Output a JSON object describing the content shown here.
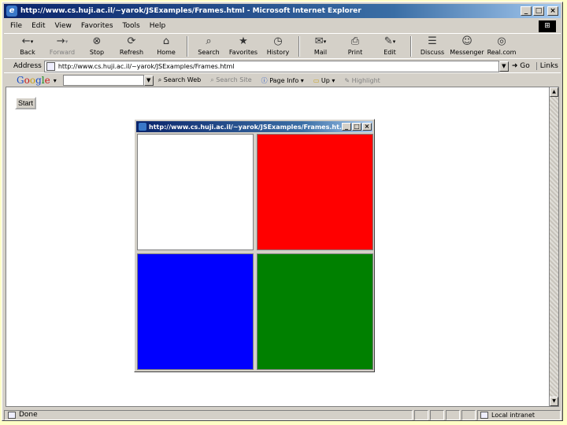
{
  "window": {
    "title": "http://www.cs.huji.ac.il/~yarok/JSExamples/Frames.html - Microsoft Internet Explorer",
    "minimize": "_",
    "maximize": "□",
    "close": "×"
  },
  "menu": [
    "File",
    "Edit",
    "View",
    "Favorites",
    "Tools",
    "Help"
  ],
  "toolbar": [
    {
      "label": "Back",
      "icon": "←",
      "name": "back",
      "dropdown": true,
      "disabled": false
    },
    {
      "label": "Forward",
      "icon": "→",
      "name": "forward",
      "dropdown": true,
      "disabled": true
    },
    {
      "label": "Stop",
      "icon": "⊗",
      "name": "stop",
      "dropdown": false,
      "disabled": false
    },
    {
      "label": "Refresh",
      "icon": "⟳",
      "name": "refresh",
      "dropdown": false,
      "disabled": false
    },
    {
      "label": "Home",
      "icon": "⌂",
      "name": "home",
      "dropdown": false,
      "disabled": false
    },
    {
      "label": "Search",
      "icon": "⌕",
      "name": "search",
      "dropdown": false,
      "disabled": false
    },
    {
      "label": "Favorites",
      "icon": "★",
      "name": "favorites",
      "dropdown": false,
      "disabled": false
    },
    {
      "label": "History",
      "icon": "◷",
      "name": "history",
      "dropdown": false,
      "disabled": false
    },
    {
      "label": "Mail",
      "icon": "✉",
      "name": "mail",
      "dropdown": true,
      "disabled": false
    },
    {
      "label": "Print",
      "icon": "⎙",
      "name": "print",
      "dropdown": false,
      "disabled": false
    },
    {
      "label": "Edit",
      "icon": "✎",
      "name": "edit",
      "dropdown": true,
      "disabled": false
    },
    {
      "label": "Discuss",
      "icon": "☰",
      "name": "discuss",
      "dropdown": false,
      "disabled": false
    },
    {
      "label": "Messenger",
      "icon": "☺",
      "name": "messenger",
      "dropdown": false,
      "disabled": false
    },
    {
      "label": "Real.com",
      "icon": "◎",
      "name": "real-com",
      "dropdown": false,
      "disabled": false
    }
  ],
  "address": {
    "label": "Address",
    "value": "http://www.cs.huji.ac.il/~yarok/JSExamples/Frames.html",
    "go": "Go",
    "links": "Links"
  },
  "googlebar": {
    "logo": [
      "G",
      "o",
      "o",
      "g",
      "l",
      "e"
    ],
    "search_web": "Search Web",
    "search_site": "Search Site",
    "page_info": "Page Info",
    "up": "Up",
    "highlight": "Highlight"
  },
  "page": {
    "start_button": "Start"
  },
  "popup": {
    "title": "http://www.cs.huji.ac.il/~yarok/JSExamples/Frames.ht...",
    "frames": [
      {
        "name": "frame-top-left",
        "color": "#ffffff"
      },
      {
        "name": "frame-top-right",
        "color": "#ff0000"
      },
      {
        "name": "frame-bottom-left",
        "color": "#0000ff"
      },
      {
        "name": "frame-bottom-right",
        "color": "#008000"
      }
    ]
  },
  "status": {
    "text": "Done",
    "zone": "Local intranet"
  }
}
